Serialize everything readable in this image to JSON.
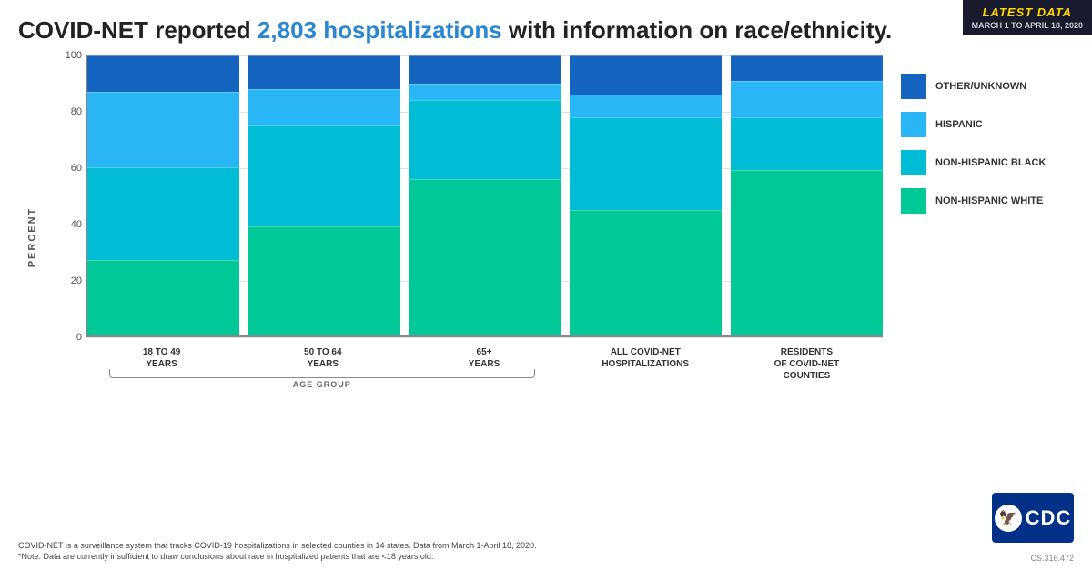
{
  "badge": {
    "title": "LATEST DATA",
    "dates": "MARCH 1 TO APRIL 18, 2020"
  },
  "title": {
    "prefix": "COVID-NET reported ",
    "highlight": "2,803 hospitalizations",
    "suffix": " with information on race/ethnicity."
  },
  "chart": {
    "y_axis_label": "PERCENT",
    "y_ticks": [
      0,
      20,
      40,
      60,
      80,
      100
    ],
    "bars": [
      {
        "label": "18 TO 49\nYEARS",
        "segments": {
          "non_hispanic_white": 27,
          "non_hispanic_black": 33,
          "hispanic": 27,
          "other_unknown": 13
        }
      },
      {
        "label": "50 TO 64\nYEARS",
        "segments": {
          "non_hispanic_white": 39,
          "non_hispanic_black": 36,
          "hispanic": 13,
          "other_unknown": 12
        }
      },
      {
        "label": "65+\nYEARS",
        "segments": {
          "non_hispanic_white": 56,
          "non_hispanic_black": 28,
          "hispanic": 6,
          "other_unknown": 10
        }
      },
      {
        "label": "ALL COVID-NET\nHOSPITALIZATIONS",
        "segments": {
          "non_hispanic_white": 45,
          "non_hispanic_black": 33,
          "hispanic": 8,
          "other_unknown": 14
        }
      },
      {
        "label": "RESIDENTS\nOF COVID-NET\nCOUNTIES",
        "segments": {
          "non_hispanic_white": 59,
          "non_hispanic_black": 19,
          "hispanic": 13,
          "other_unknown": 9
        }
      }
    ],
    "age_bracket_label": "AGE GROUP",
    "colors": {
      "non_hispanic_white": "#00c897",
      "non_hispanic_black": "#00bcd4",
      "hispanic": "#29b6f6",
      "other_unknown": "#1565c0"
    }
  },
  "legend": {
    "items": [
      {
        "key": "other_unknown",
        "label": "OTHER/UNKNOWN",
        "color": "#1565c0"
      },
      {
        "key": "hispanic",
        "label": "HISPANIC",
        "color": "#29b6f6"
      },
      {
        "key": "non_hispanic_black",
        "label": "NON-HISPANIC BLACK",
        "color": "#00bcd4"
      },
      {
        "key": "non_hispanic_white",
        "label": "NON-HISPANIC WHITE",
        "color": "#00c897"
      }
    ]
  },
  "footnotes": [
    "COVID-NET is a surveillance system that tracks COVID-19 hospitalizations in selected counties in 14 states. Data from March 1-April 18, 2020.",
    "*Note: Data are currently insufficient to draw conclusions about race in hospitalized patients that are <18 years old."
  ],
  "chart_id": "CS.316.472"
}
